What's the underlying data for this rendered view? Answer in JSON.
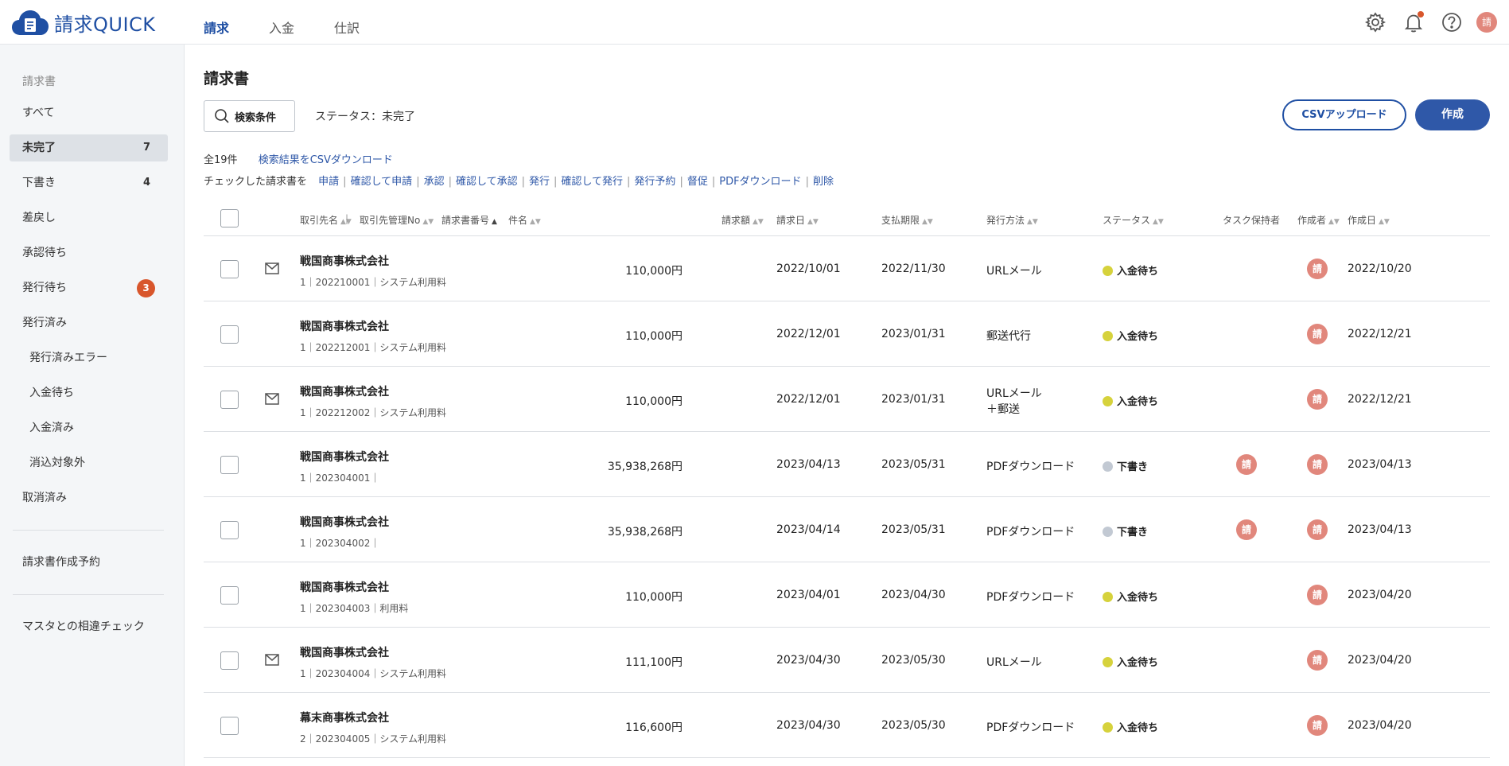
{
  "app": {
    "logo_text": "請求QUICK",
    "avatar_text": "請",
    "brand_color": "#1f4fa3",
    "accent_color": "#2f58a8",
    "badge_color": "#d8562c"
  },
  "topnav": [
    {
      "label": "請求",
      "active": true
    },
    {
      "label": "入金",
      "active": false
    },
    {
      "label": "仕訳",
      "active": false
    }
  ],
  "header_icons": [
    "gear-icon",
    "bell-icon",
    "help-icon",
    "user-avatar"
  ],
  "sidebar": {
    "section_label": "請求書",
    "items": [
      {
        "label": "すべて",
        "count": ""
      },
      {
        "label": "未完了",
        "count": "7",
        "active": true
      },
      {
        "label": "下書き",
        "count": "4"
      },
      {
        "label": "差戻し",
        "count": ""
      },
      {
        "label": "承認待ち",
        "count": ""
      },
      {
        "label": "発行待ち",
        "badge": "3"
      },
      {
        "label": "発行済み",
        "count": ""
      },
      {
        "label": "発行済みエラー",
        "sub": true
      },
      {
        "label": "入金待ち",
        "sub": true
      },
      {
        "label": "入金済み",
        "sub": true
      },
      {
        "label": "消込対象外",
        "sub": true
      },
      {
        "label": "取消済み",
        "count": ""
      }
    ],
    "reservation": "請求書作成予約",
    "master_check": "マスタとの相違チェック"
  },
  "main": {
    "title": "請求書",
    "search_button": "検索条件",
    "status_filter": "ステータス：未完了",
    "csv_upload": "CSVアップロード",
    "create": "作成",
    "total": "全19件",
    "csv_download_link": "検索結果をCSVダウンロード",
    "bulk_prefix": "チェックした請求書を",
    "bulk_actions": [
      "申請",
      "確認して申請",
      "承認",
      "確認して承認",
      "発行",
      "確認して発行",
      "発行予約",
      "督促",
      "PDFダウンロード",
      "削除"
    ]
  },
  "table": {
    "columns": {
      "client": "取引先名",
      "client_no": "取引先管理No",
      "invoice_no": "請求書番号",
      "subject": "件名",
      "amount": "請求額",
      "invoice_date": "請求日",
      "due_date": "支払期限",
      "method": "発行方法",
      "status": "ステータス",
      "task_owner": "タスク保持者",
      "creator": "作成者",
      "created": "作成日"
    },
    "rows": [
      {
        "mail": true,
        "client": "戦国商事株式会社",
        "meta": "1｜202210001｜システム利用料",
        "amount": "110,000円",
        "invoice_date": "2022/10/01",
        "due_date": "2022/11/30",
        "method": "URLメール",
        "method2": "",
        "status": "入金待ち",
        "status_color": "#d6d23c",
        "task_owner": "",
        "creator": "請",
        "created": "2022/10/20"
      },
      {
        "mail": false,
        "client": "戦国商事株式会社",
        "meta": "1｜202212001｜システム利用料",
        "amount": "110,000円",
        "invoice_date": "2022/12/01",
        "due_date": "2023/01/31",
        "method": "郵送代行",
        "method2": "",
        "status": "入金待ち",
        "status_color": "#d6d23c",
        "task_owner": "",
        "creator": "請",
        "created": "2022/12/21"
      },
      {
        "mail": true,
        "client": "戦国商事株式会社",
        "meta": "1｜202212002｜システム利用料",
        "amount": "110,000円",
        "invoice_date": "2022/12/01",
        "due_date": "2023/01/31",
        "method": "URLメール",
        "method2": "＋郵送",
        "status": "入金待ち",
        "status_color": "#d6d23c",
        "task_owner": "",
        "creator": "請",
        "created": "2022/12/21"
      },
      {
        "mail": false,
        "client": "戦国商事株式会社",
        "meta": "1｜202304001｜",
        "amount": "35,938,268円",
        "invoice_date": "2023/04/13",
        "due_date": "2023/05/31",
        "method": "PDFダウンロード",
        "method2": "",
        "status": "下書き",
        "status_color": "#c2c9d3",
        "task_owner": "請",
        "creator": "請",
        "created": "2023/04/13"
      },
      {
        "mail": false,
        "client": "戦国商事株式会社",
        "meta": "1｜202304002｜",
        "amount": "35,938,268円",
        "invoice_date": "2023/04/14",
        "due_date": "2023/05/31",
        "method": "PDFダウンロード",
        "method2": "",
        "status": "下書き",
        "status_color": "#c2c9d3",
        "task_owner": "請",
        "creator": "請",
        "created": "2023/04/13"
      },
      {
        "mail": false,
        "client": "戦国商事株式会社",
        "meta": "1｜202304003｜利用料",
        "amount": "110,000円",
        "invoice_date": "2023/04/01",
        "due_date": "2023/04/30",
        "method": "PDFダウンロード",
        "method2": "",
        "status": "入金待ち",
        "status_color": "#d6d23c",
        "task_owner": "",
        "creator": "請",
        "created": "2023/04/20"
      },
      {
        "mail": true,
        "client": "戦国商事株式会社",
        "meta": "1｜202304004｜システム利用料",
        "amount": "111,100円",
        "invoice_date": "2023/04/30",
        "due_date": "2023/05/30",
        "method": "URLメール",
        "method2": "",
        "status": "入金待ち",
        "status_color": "#d6d23c",
        "task_owner": "",
        "creator": "請",
        "created": "2023/04/20"
      },
      {
        "mail": false,
        "client": "幕末商事株式会社",
        "meta": "2｜202304005｜システム利用料",
        "amount": "116,600円",
        "invoice_date": "2023/04/30",
        "due_date": "2023/05/30",
        "method": "PDFダウンロード",
        "method2": "",
        "status": "入金待ち",
        "status_color": "#d6d23c",
        "task_owner": "",
        "creator": "請",
        "created": "2023/04/20"
      }
    ]
  }
}
